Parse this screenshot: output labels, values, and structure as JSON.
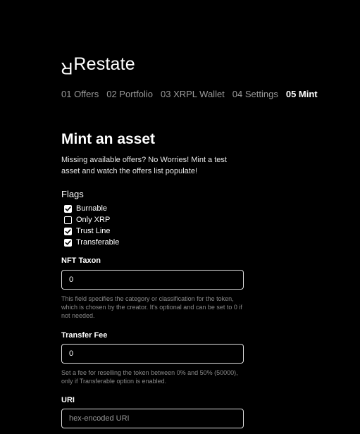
{
  "brand": {
    "mark": "R",
    "name": "Restate"
  },
  "nav": [
    {
      "label": "01 Offers",
      "active": false
    },
    {
      "label": "02 Portfolio",
      "active": false
    },
    {
      "label": "03 XRPL Wallet",
      "active": false
    },
    {
      "label": "04 Settings",
      "active": false
    },
    {
      "label": "05 Mint",
      "active": true
    }
  ],
  "page": {
    "title": "Mint an asset",
    "intro": "Missing available offers? No Worries! Mint a test asset and watch the offers list populate!"
  },
  "flags": {
    "label": "Flags",
    "items": [
      {
        "label": "Burnable",
        "checked": true
      },
      {
        "label": "Only XRP",
        "checked": false
      },
      {
        "label": "Trust Line",
        "checked": true
      },
      {
        "label": "Transferable",
        "checked": true
      }
    ]
  },
  "nft_taxon": {
    "label": "NFT Taxon",
    "value": "0",
    "help": "This field specifies the category or classification for the token, which is chosen by the creator. It's optional and can be set to 0 if not needed."
  },
  "transfer_fee": {
    "label": "Transfer Fee",
    "value": "0",
    "help": "Set a fee for reselling the token between 0% and 50% (50000), only if Transferable option is enabled."
  },
  "uri": {
    "label": "URI",
    "value": "",
    "placeholder": "hex-encoded URI"
  }
}
